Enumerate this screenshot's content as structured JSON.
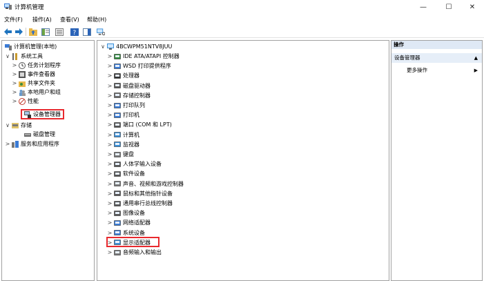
{
  "window": {
    "title": "计算机管理",
    "minimize": "—",
    "maximize": "☐",
    "close": "✕"
  },
  "menu": [
    "文件(F)",
    "操作(A)",
    "查看(V)",
    "帮助(H)"
  ],
  "left_tree": [
    {
      "label": "计算机管理(本地)",
      "icon": "computer-management-icon",
      "chev": ""
    },
    {
      "label": "系统工具",
      "icon": "system-tools-icon",
      "chev": "∨"
    },
    {
      "label": "任务计划程序",
      "icon": "task-scheduler-icon",
      "chev": ">"
    },
    {
      "label": "事件查看器",
      "icon": "event-viewer-icon",
      "chev": ">"
    },
    {
      "label": "共享文件夹",
      "icon": "shared-folders-icon",
      "chev": ">"
    },
    {
      "label": "本地用户和组",
      "icon": "local-users-icon",
      "chev": ">"
    },
    {
      "label": "性能",
      "icon": "performance-icon",
      "chev": ">"
    },
    {
      "label": "设备管理器",
      "icon": "device-manager-icon",
      "chev": ""
    },
    {
      "label": "存储",
      "icon": "storage-icon",
      "chev": "∨"
    },
    {
      "label": "磁盘管理",
      "icon": "disk-management-icon",
      "chev": ""
    },
    {
      "label": "服务和应用程序",
      "icon": "services-icon",
      "chev": ">"
    }
  ],
  "device_tree": {
    "root": "4BCWPM51NTV8JUU",
    "items": [
      {
        "label": "IDE ATA/ATAPI 控制器",
        "icon": "ide-controller-icon"
      },
      {
        "label": "WSD 打印提供程序",
        "icon": "wsd-print-icon"
      },
      {
        "label": "处理器",
        "icon": "processor-icon"
      },
      {
        "label": "磁盘驱动器",
        "icon": "disk-drive-icon"
      },
      {
        "label": "存储控制器",
        "icon": "storage-controller-icon"
      },
      {
        "label": "打印队列",
        "icon": "print-queue-icon"
      },
      {
        "label": "打印机",
        "icon": "printer-icon"
      },
      {
        "label": "端口 (COM 和 LPT)",
        "icon": "port-icon"
      },
      {
        "label": "计算机",
        "icon": "computer-icon"
      },
      {
        "label": "监视器",
        "icon": "monitor-icon"
      },
      {
        "label": "键盘",
        "icon": "keyboard-icon"
      },
      {
        "label": "人体学输入设备",
        "icon": "hid-icon"
      },
      {
        "label": "软件设备",
        "icon": "software-device-icon"
      },
      {
        "label": "声音、视频和游戏控制器",
        "icon": "sound-icon"
      },
      {
        "label": "鼠标和其他指针设备",
        "icon": "mouse-icon"
      },
      {
        "label": "通用串行总线控制器",
        "icon": "usb-icon"
      },
      {
        "label": "图像设备",
        "icon": "imaging-icon"
      },
      {
        "label": "网络适配器",
        "icon": "network-adapter-icon"
      },
      {
        "label": "系统设备",
        "icon": "system-device-icon"
      },
      {
        "label": "显示适配器",
        "icon": "display-adapter-icon"
      },
      {
        "label": "音频输入和输出",
        "icon": "audio-io-icon"
      }
    ]
  },
  "actions": {
    "header": "操作",
    "section": "设备管理器",
    "more": "更多操作",
    "section_arrow": "▲",
    "more_arrow": "▶"
  },
  "colors": {
    "highlight": "#e8292e",
    "accent": "#1e73be"
  }
}
